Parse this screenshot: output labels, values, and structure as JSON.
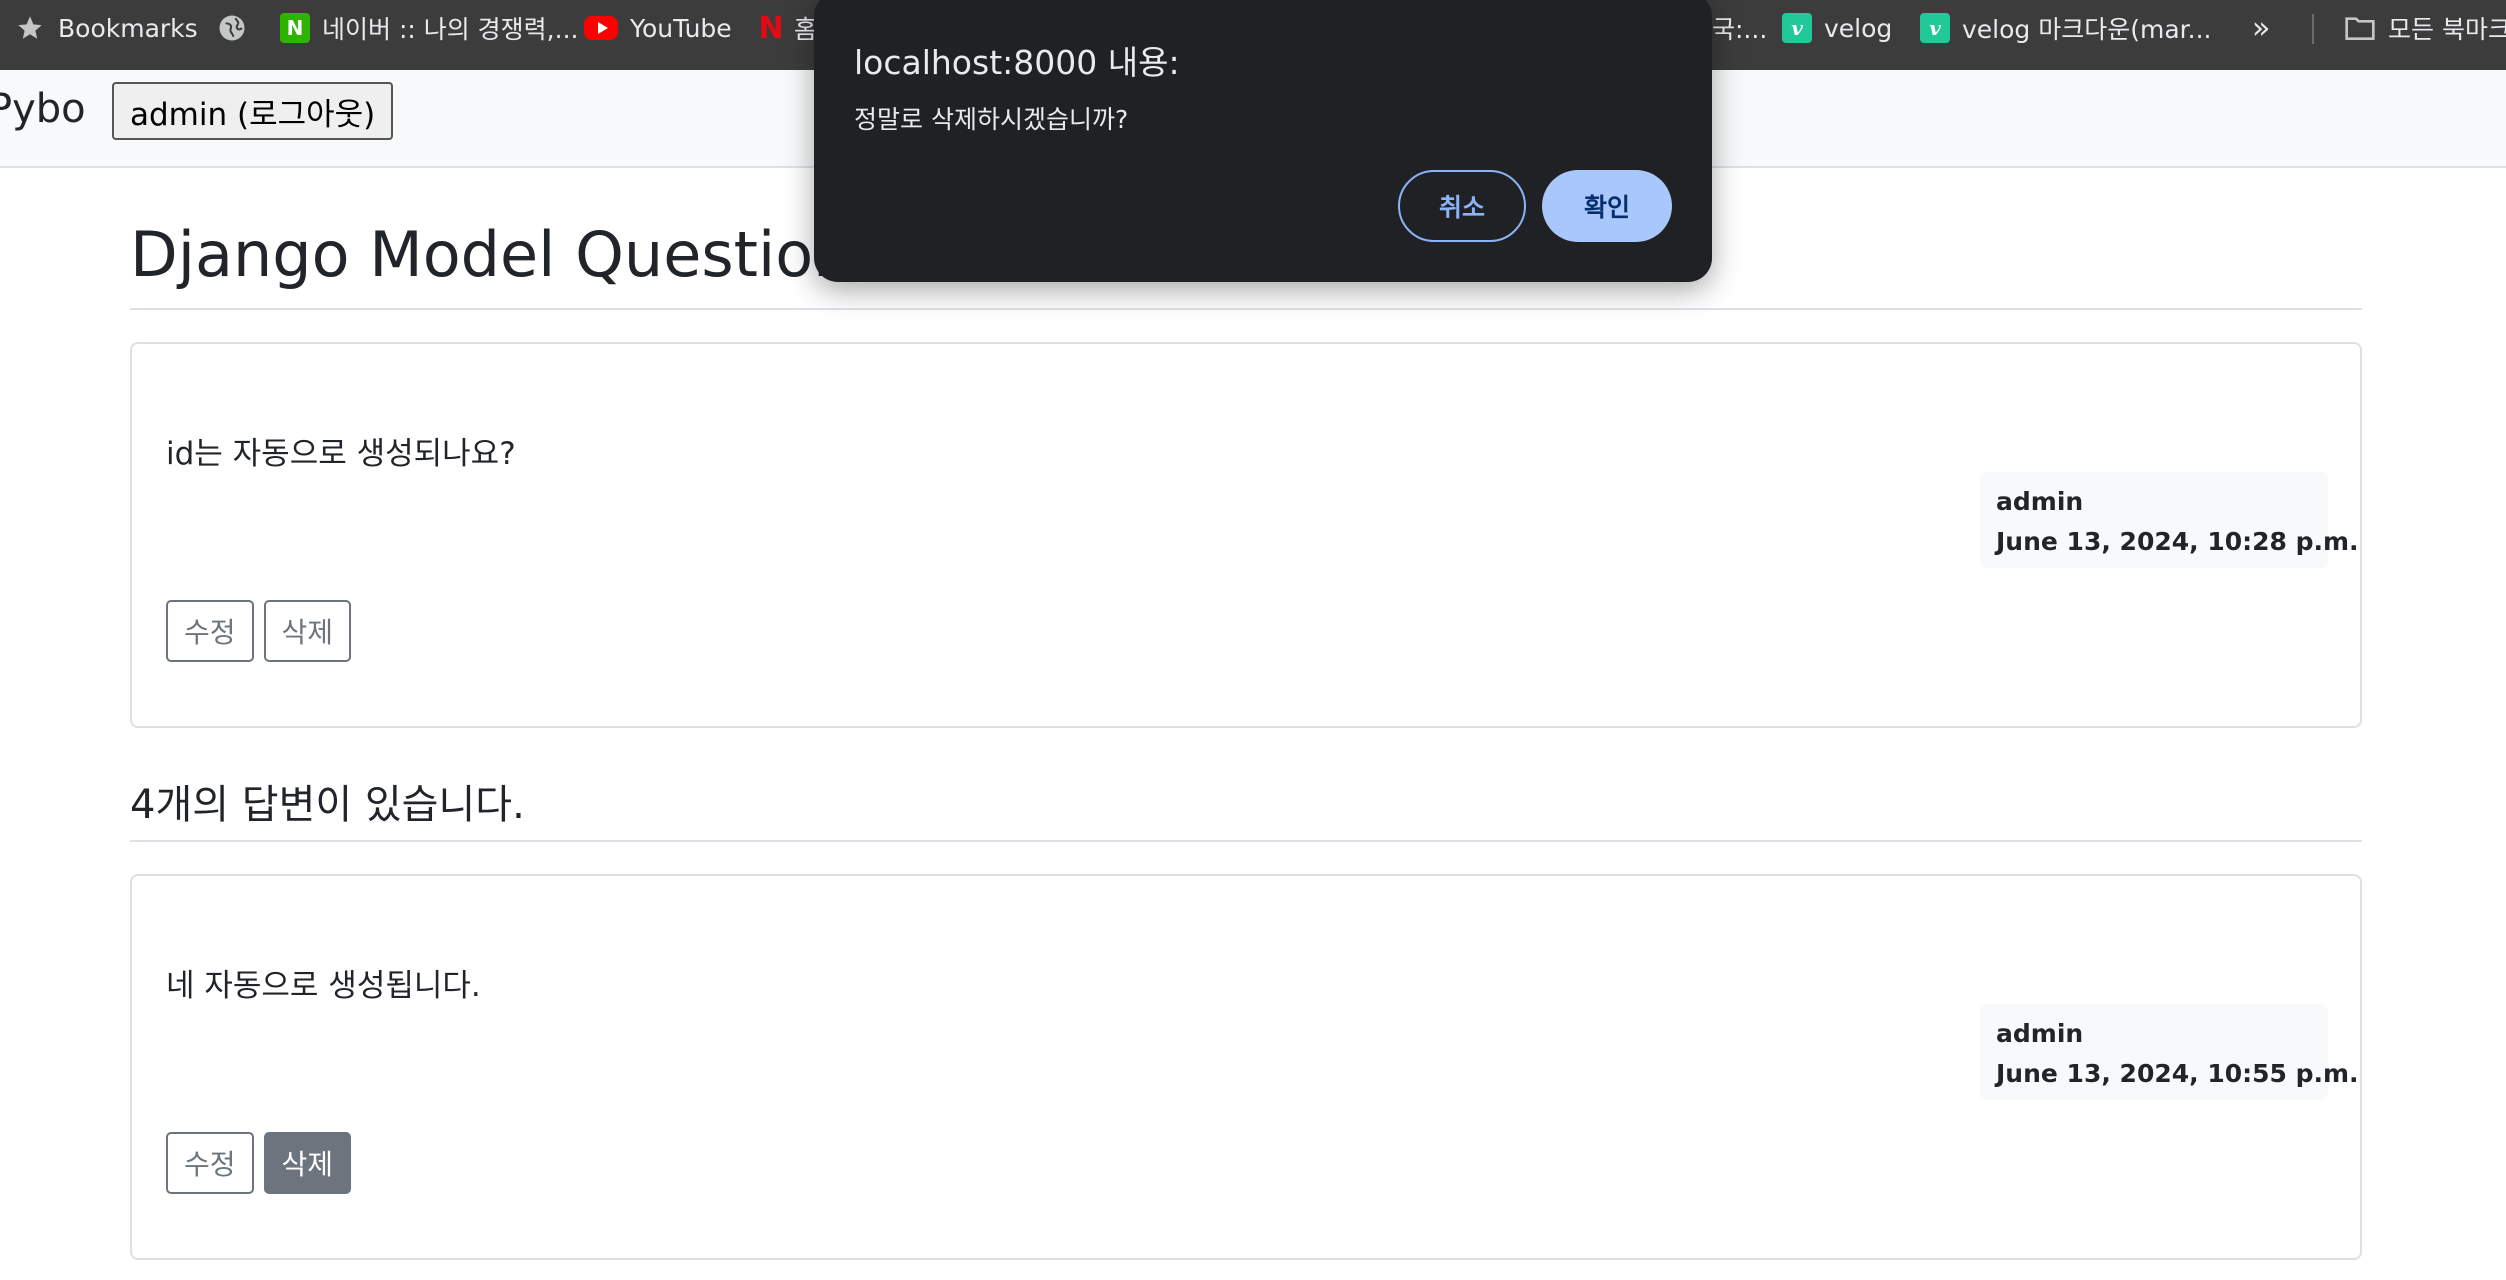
{
  "bookmarks": {
    "items": [
      {
        "label": "Bookmarks",
        "icon": "star-icon"
      },
      {
        "label": "",
        "icon": "globe-icon"
      },
      {
        "label": "네이버 :: 나의 경쟁력,...",
        "icon": "naver-icon"
      },
      {
        "label": "YouTube",
        "icon": "youtube-icon"
      },
      {
        "label": "홈",
        "icon": "netflix-icon"
      },
      {
        "label": "국:...",
        "icon": ""
      },
      {
        "label": "velog",
        "icon": "velog-icon"
      },
      {
        "label": "velog 마크다운(mar...",
        "icon": "velog-icon"
      }
    ],
    "overflow": "»",
    "all_bookmarks": "모든 북마크"
  },
  "navbar": {
    "brand": "Pybo",
    "user_button": "admin (로그아웃)"
  },
  "question": {
    "title": "Django Model Question",
    "content": "id는 자동으로 생성되나요?",
    "author": "admin",
    "date": "June 13, 2024, 10:28 p.m.",
    "edit_label": "수정",
    "delete_label": "삭제"
  },
  "answers": {
    "heading": "4개의 답변이 있습니다.",
    "items": [
      {
        "content": "네 자동으로 생성됩니다.",
        "author": "admin",
        "date": "June 13, 2024, 10:55 p.m.",
        "edit_label": "수정",
        "delete_label": "삭제"
      }
    ]
  },
  "dialog": {
    "title": "localhost:8000 내용:",
    "message": "정말로 삭제하시겠습니까?",
    "cancel_label": "취소",
    "ok_label": "확인"
  }
}
